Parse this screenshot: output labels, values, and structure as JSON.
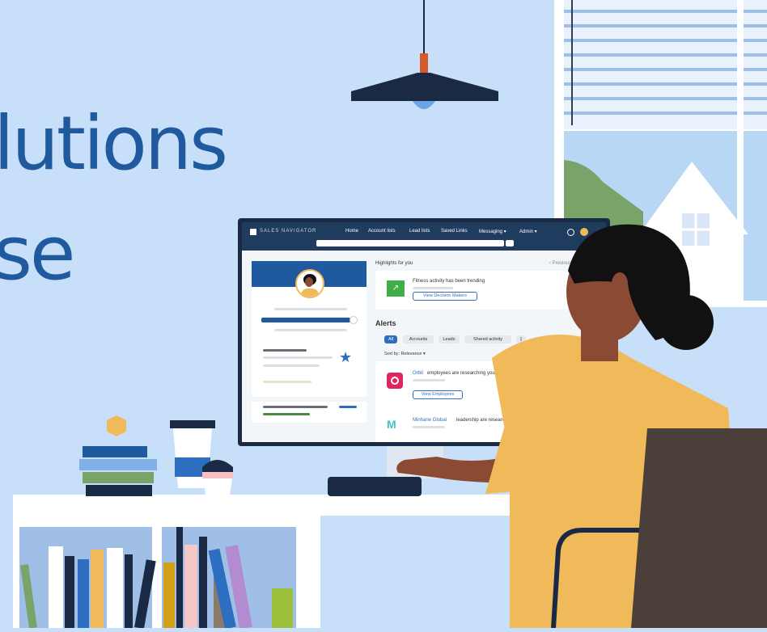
{
  "headline": {
    "line1": "lutions",
    "line2": "se"
  },
  "app": {
    "brand": "SALES NAVIGATOR",
    "nav_items": [
      "Home",
      "Account lists",
      "Lead lists",
      "Saved Links",
      "Messaging ▾",
      "Admin ▾"
    ],
    "highlights_title": "Highlights for you",
    "highlights_link": "‹ Previous",
    "highlight_card": {
      "text": "Fitness activity has been trending",
      "button": "View Decision Makers"
    },
    "alerts_title": "Alerts",
    "alert_filters": [
      "All",
      "Accounts",
      "Leads",
      "Shared activity",
      "▯"
    ],
    "sort_label": "Sort by: Relevance ▾",
    "alert_items": [
      {
        "company": "Orbit",
        "text": "employees are researching your company",
        "button": "View Employees"
      },
      {
        "company": "Minhane Global",
        "text": "leadership are researching"
      }
    ]
  },
  "colors": {
    "background": "#c8dff9",
    "headline": "#1f5a9e",
    "navbar": "#1f3b5e",
    "accent_blue": "#2d6ec0",
    "shirt": "#f0b959",
    "skin": "#8a4a34",
    "hair": "#111111",
    "chair": "#4a4039"
  },
  "icons": [
    "pendant-lamp-icon",
    "window-blinds-icon",
    "house-icon",
    "book-stack-icon",
    "coffee-cup-icon",
    "keyboard-icon",
    "chair-icon"
  ]
}
